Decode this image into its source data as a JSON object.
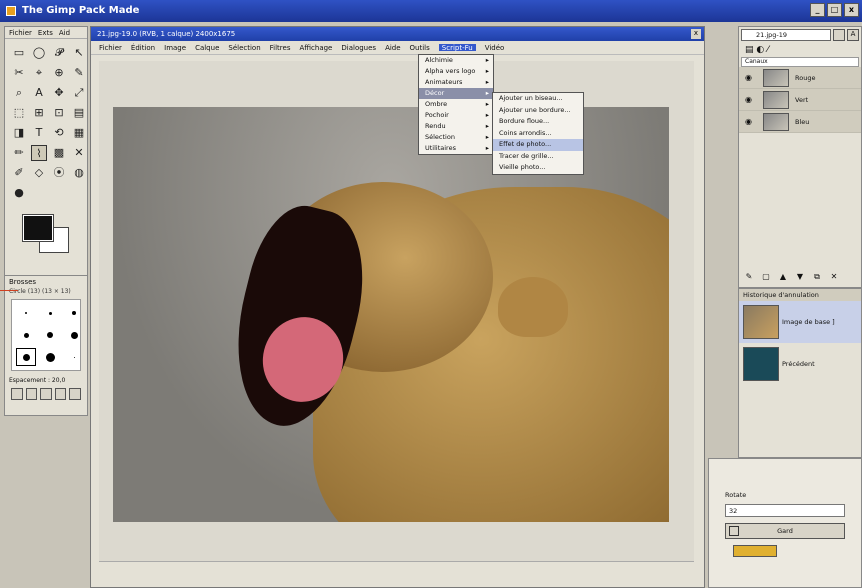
{
  "app": {
    "title": "The Gimp Pack Made",
    "window_buttons": [
      "_",
      "□",
      "x"
    ]
  },
  "toolbox": {
    "menu": [
      "Fichier",
      "Exts",
      "Aid"
    ],
    "tools": [
      "▭",
      "◯",
      "𝓟",
      "↖",
      "✂",
      "⌖",
      "⊕",
      "✎",
      "⌕",
      "A",
      "✥",
      "⤢",
      "⬚",
      "⊞",
      "⊡",
      "▤",
      "◨",
      "T",
      "⟲",
      "▦",
      "✏",
      "⌇",
      "▩",
      "✕",
      "✐",
      "◇",
      "⦿",
      "◍",
      "●"
    ],
    "brushes": {
      "title": "Brosses",
      "subtitle": "Circle (13) (13 × 13)",
      "spacing_label": "Espacement : 20,0"
    }
  },
  "image_window": {
    "title": "21.jpg-19.0 (RVB, 1 calque) 2400x1675",
    "menu": [
      "Fichier",
      "Édition",
      "Image",
      "Calque",
      "Sélection",
      "Filtres",
      "Affichage",
      "Dialogues",
      "Aide",
      "Outils",
      "Script-Fu",
      "Vidéo"
    ],
    "open_menu_index": 10
  },
  "scriptfu_menu": {
    "items": [
      "Alchimie",
      "Alpha vers logo",
      "Animateurs",
      "Décor",
      "Ombre",
      "Pochoir",
      "Rendu",
      "Sélection",
      "Utilitaires"
    ],
    "selected_index": 3
  },
  "decor_submenu": {
    "items": [
      "Ajouter un biseau...",
      "Ajouter une bordure...",
      "Bordure floue...",
      "Coins arrondis...",
      "Effet de photo...",
      "Tracer de grille...",
      "Vieille photo..."
    ],
    "highlighted_index": 4
  },
  "layers": {
    "image_select": "21.jpg-19",
    "auto_button": "A",
    "mode": "Canaux",
    "channels": [
      "Rouge",
      "Vert",
      "Bleu"
    ]
  },
  "history": {
    "title": "Historique d'annulation",
    "entries": [
      "Image de base ]",
      "Précédent"
    ]
  },
  "dialog": {
    "field_label": "Rotate",
    "field_value": "32",
    "button_label": "Gard"
  }
}
